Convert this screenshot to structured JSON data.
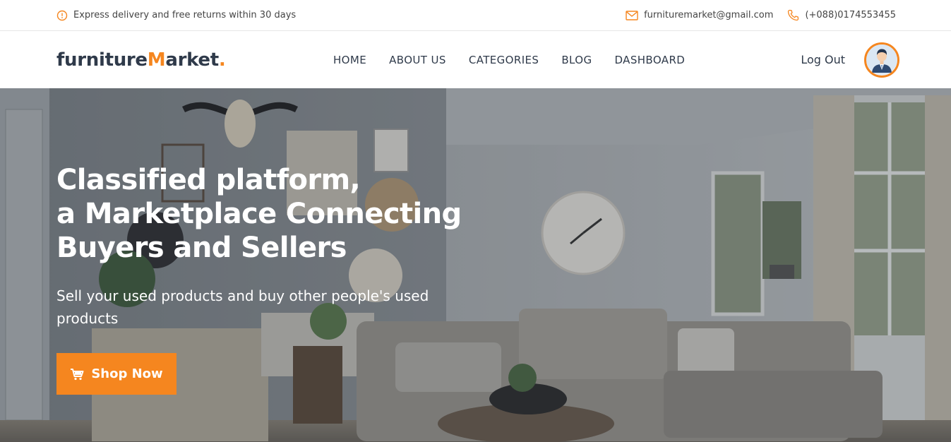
{
  "topbar": {
    "notice": "Express delivery and free returns within 30 days",
    "email": "furnituremarket@gmail.com",
    "phone": "(+088)0174553455"
  },
  "logo": {
    "part1": "furniture",
    "accent_letter": "M",
    "part2": "arket",
    "dot": "."
  },
  "nav": {
    "items": [
      {
        "label": "HOME"
      },
      {
        "label": "ABOUT US"
      },
      {
        "label": "CATEGORIES"
      },
      {
        "label": "BLOG"
      },
      {
        "label": "DASHBOARD"
      }
    ],
    "logout_label": "Log Out"
  },
  "hero": {
    "title_line1": "Classified platform,",
    "title_line2": "a Marketplace Connecting",
    "title_line3": "Buyers and Sellers",
    "subtitle": "Sell your used products and buy other people's used products",
    "cta_label": "Shop Now"
  },
  "colors": {
    "accent": "#f5861f",
    "text_dark": "#2f3a4a"
  },
  "icons": [
    "info-circle-icon",
    "mail-icon",
    "phone-icon",
    "user-avatar-icon",
    "cart-icon"
  ]
}
